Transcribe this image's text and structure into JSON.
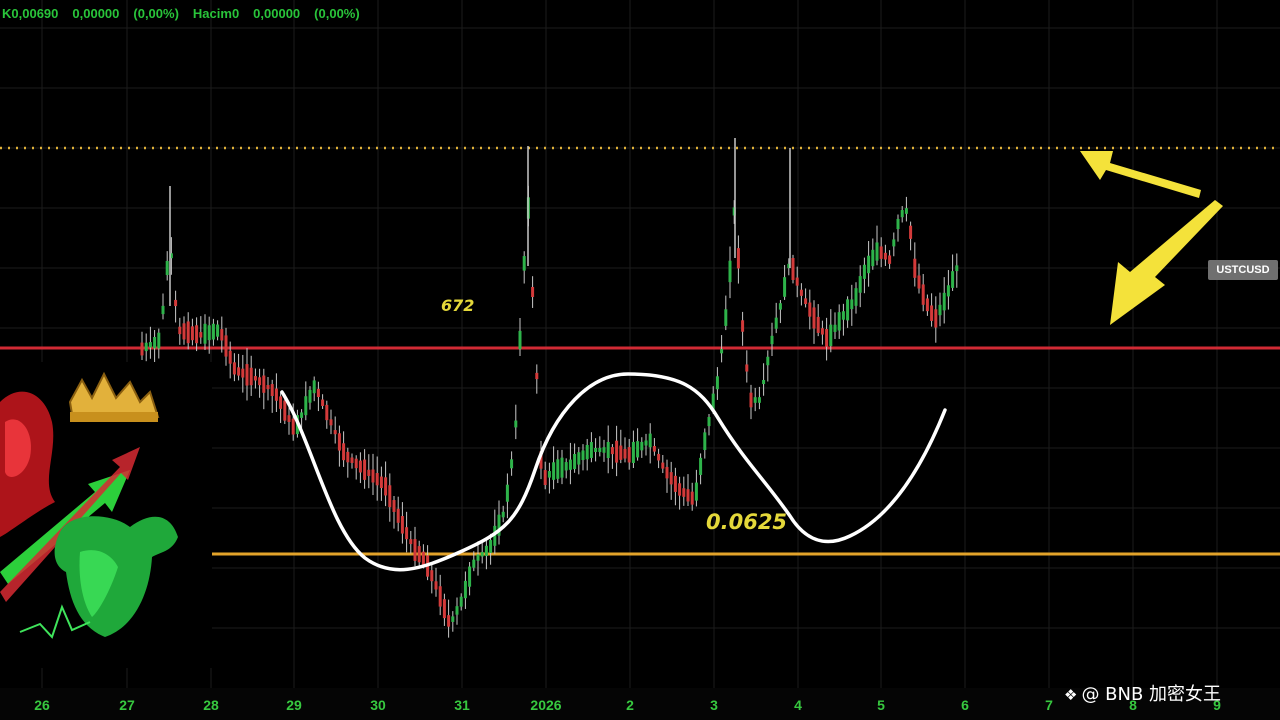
{
  "header": {
    "ohlc_fragment": "K0,00690",
    "change_value": "0,00000",
    "change_pct": "(0,00%)",
    "volume_label": "Hacim0",
    "volume_value": "0,00000",
    "volume_pct": "(0,00%)"
  },
  "symbol_tag": "USTCUSD",
  "annotations": {
    "upper_label": "672",
    "lower_label": "0.0625"
  },
  "watermark": "@ BNB 加密女王",
  "colors": {
    "background": "#000000",
    "grid": "#1c1c1c",
    "resistance_dotted": "#e0b23a",
    "red_level": "#d12a34",
    "support_level": "#e3a32a",
    "bull_candle": "#2eb34a",
    "bear_candle": "#d33a3a",
    "wick": "#c8c8c8",
    "pattern_curve": "#ffffff",
    "arrows": "#f4e23a",
    "axis_text": "#37c83f"
  },
  "chart_data": {
    "type": "candlestick",
    "symbol": "USTCUSD",
    "x_tick_labels": [
      "26",
      "27",
      "28",
      "29",
      "30",
      "31",
      "2026",
      "2",
      "3",
      "4",
      "5",
      "6",
      "7",
      "8",
      "9"
    ],
    "horizontal_levels": [
      {
        "style": "dotted",
        "color": "#e0b23a"
      },
      {
        "style": "solid",
        "color": "#d12a34"
      },
      {
        "style": "solid",
        "color": "#e3a32a"
      }
    ],
    "annotations": [
      "672",
      "0.0625"
    ],
    "grid": true
  }
}
